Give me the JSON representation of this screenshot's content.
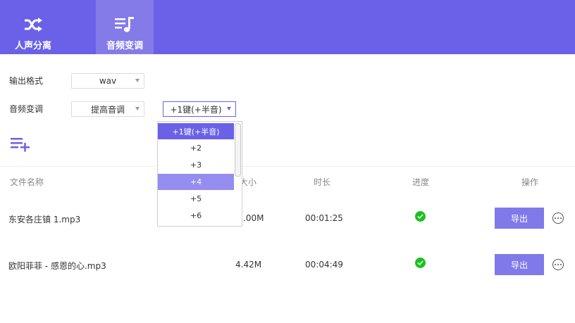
{
  "tabs": [
    {
      "label": "人声分离",
      "icon": "shuffle-icon",
      "active": false
    },
    {
      "label": "音频变调",
      "icon": "music-list-icon",
      "active": true
    }
  ],
  "colors": {
    "accent": "#6b61e8",
    "tab_active": "#847be9",
    "success": "#19c31f",
    "export_button": "#7f79ea",
    "hover_option": "#958def"
  },
  "form": {
    "output_format": {
      "label": "输出格式",
      "value": "wav"
    },
    "pitch": {
      "label": "音频变调",
      "mode_value": "提高音调",
      "amount_value": "+1键(+半音)"
    }
  },
  "dropdown": {
    "options": [
      "+1键(+半音)",
      "+2",
      "+3",
      "+4",
      "+5",
      "+6"
    ],
    "selected_index": 0,
    "hover_index": 3
  },
  "table": {
    "headers": {
      "name": "文件名称",
      "size": "大小",
      "duration": "时长",
      "progress": "进度",
      "action": "操作"
    },
    "rows": [
      {
        "name": "东安各庄镇 1.mp3",
        "size": ".00M",
        "duration": "00:01:25",
        "status": "complete",
        "export_label": "导出"
      },
      {
        "name": "欧阳菲菲 - 感恩的心.mp3",
        "size": "4.42M",
        "duration": "00:04:49",
        "status": "complete",
        "export_label": "导出"
      }
    ]
  }
}
